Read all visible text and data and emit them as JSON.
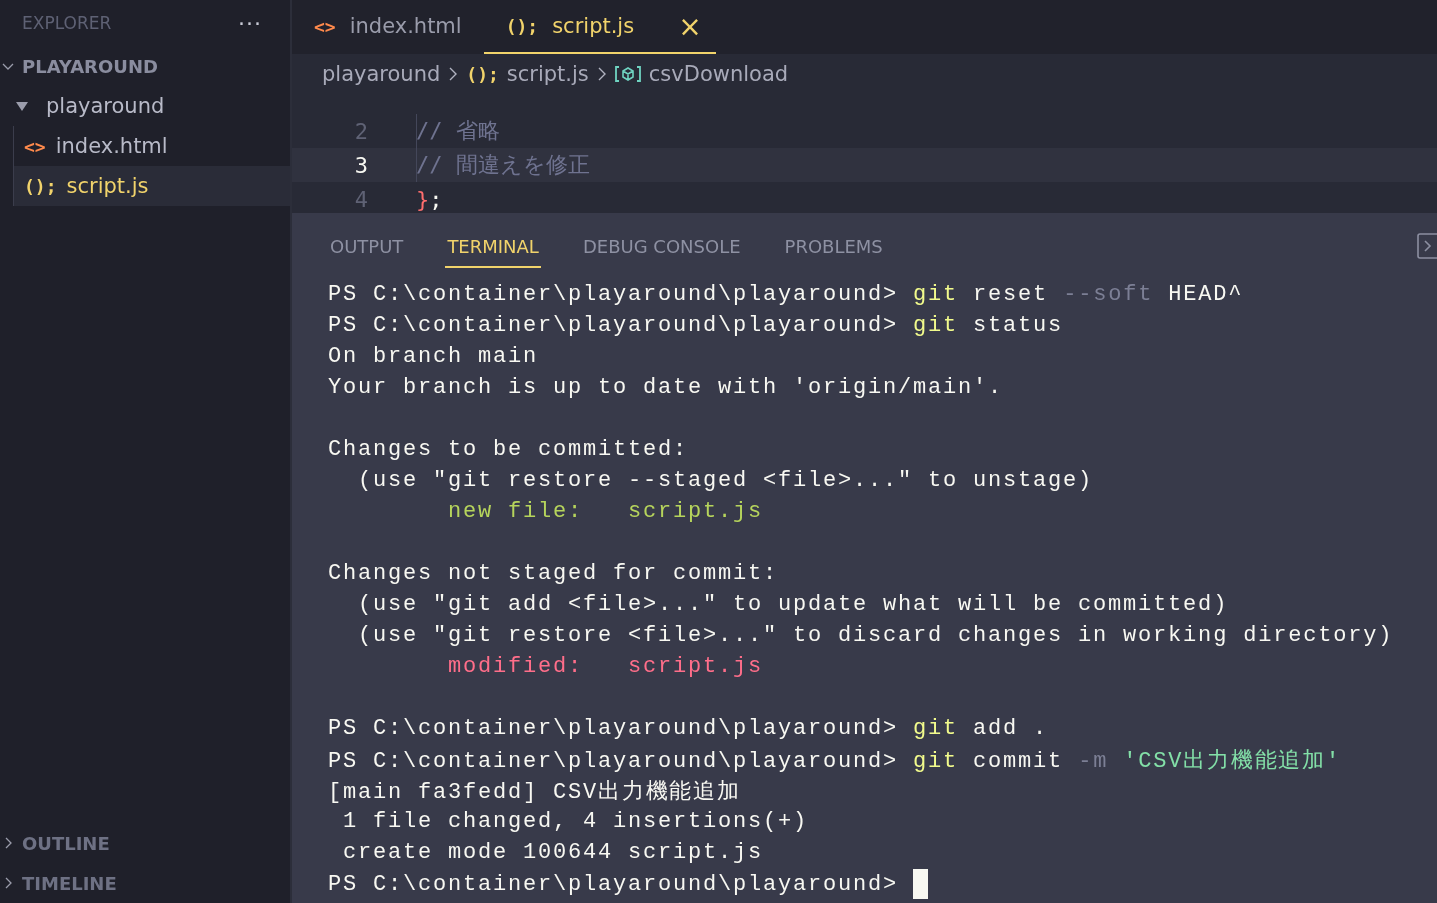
{
  "sidebar": {
    "title": "EXPLORER",
    "more": "···",
    "sections": [
      {
        "label": "PLAYAROUND",
        "expanded": true,
        "tree": [
          {
            "label": "playaround",
            "kind": "folder",
            "expanded": true,
            "selected": false,
            "children": [
              {
                "label": "index.html",
                "kind": "html",
                "icon": "<>",
                "selected": false
              },
              {
                "label": "script.js",
                "kind": "js",
                "icon": "();",
                "selected": true
              }
            ]
          }
        ]
      }
    ],
    "bottom_sections": [
      {
        "label": "OUTLINE",
        "expanded": false
      },
      {
        "label": "TIMELINE",
        "expanded": false
      }
    ]
  },
  "tabs": [
    {
      "label": "index.html",
      "kind": "html",
      "icon": "<>",
      "selected": false
    },
    {
      "label": "script.js",
      "kind": "js",
      "icon": "();",
      "selected": true,
      "close": "×"
    }
  ],
  "breadcrumbs": [
    {
      "label": "playaround",
      "kind": "folder"
    },
    {
      "label": "script.js",
      "kind": "js",
      "icon": "();"
    },
    {
      "label": "csvDownload",
      "kind": "symbol"
    }
  ],
  "code": [
    {
      "number": "2",
      "current": false,
      "tokens": [
        {
          "kind": "comment",
          "text": "// 省略"
        }
      ]
    },
    {
      "number": "3",
      "current": true,
      "tokens": [
        {
          "kind": "comment",
          "text": "// 間違えを修正"
        }
      ]
    },
    {
      "number": "4",
      "current": false,
      "tokens": [
        {
          "kind": "op",
          "text": "}"
        },
        {
          "kind": "plain",
          "text": ";"
        }
      ]
    }
  ],
  "panel_tabs": [
    {
      "label": "OUTPUT",
      "selected": false
    },
    {
      "label": "TERMINAL",
      "selected": true
    },
    {
      "label": "DEBUG CONSOLE",
      "selected": false
    },
    {
      "label": "PROBLEMS",
      "selected": false
    }
  ],
  "terminal": [
    {
      "kind": "text",
      "segments": [
        {
          "kind": "plain",
          "text": "PS C:\\container\\playaround\\playaround> "
        },
        {
          "kind": "cmd",
          "text": "git"
        },
        {
          "kind": "plain",
          "text": " reset "
        },
        {
          "kind": "flag",
          "text": "--soft"
        },
        {
          "kind": "plain",
          "text": " HEAD^"
        }
      ]
    },
    {
      "kind": "text",
      "segments": [
        {
          "kind": "plain",
          "text": "PS C:\\container\\playaround\\playaround> "
        },
        {
          "kind": "cmd",
          "text": "git"
        },
        {
          "kind": "plain",
          "text": " status"
        }
      ]
    },
    {
      "kind": "text",
      "segments": [
        {
          "kind": "plain",
          "text": "On branch main"
        }
      ]
    },
    {
      "kind": "text",
      "segments": [
        {
          "kind": "plain",
          "text": "Your branch is up to date with 'origin/main'."
        }
      ]
    },
    {
      "kind": "blank"
    },
    {
      "kind": "text",
      "segments": [
        {
          "kind": "plain",
          "text": "Changes to be committed:"
        }
      ]
    },
    {
      "kind": "text",
      "segments": [
        {
          "kind": "plain",
          "text": "  (use \"git restore --staged <file>...\" to unstage)"
        }
      ]
    },
    {
      "kind": "text",
      "segments": [
        {
          "kind": "added",
          "text": "        new file:   script.js"
        }
      ]
    },
    {
      "kind": "blank"
    },
    {
      "kind": "text",
      "segments": [
        {
          "kind": "plain",
          "text": "Changes not staged for commit:"
        }
      ]
    },
    {
      "kind": "text",
      "segments": [
        {
          "kind": "plain",
          "text": "  (use \"git add <file>...\" to update what will be committed)"
        }
      ]
    },
    {
      "kind": "text",
      "segments": [
        {
          "kind": "plain",
          "text": "  (use \"git restore <file>...\" to discard changes in working directory)"
        }
      ]
    },
    {
      "kind": "text",
      "segments": [
        {
          "kind": "modified",
          "text": "        modified:   script.js"
        }
      ]
    },
    {
      "kind": "blank"
    },
    {
      "kind": "text",
      "segments": [
        {
          "kind": "plain",
          "text": "PS C:\\container\\playaround\\playaround> "
        },
        {
          "kind": "cmd",
          "text": "git"
        },
        {
          "kind": "plain",
          "text": " add ."
        }
      ]
    },
    {
      "kind": "text",
      "segments": [
        {
          "kind": "plain",
          "text": "PS C:\\container\\playaround\\playaround> "
        },
        {
          "kind": "cmd",
          "text": "git"
        },
        {
          "kind": "plain",
          "text": " commit "
        },
        {
          "kind": "flag",
          "text": "-m"
        },
        {
          "kind": "string",
          "text": " 'CSV出力機能追加'"
        }
      ]
    },
    {
      "kind": "text",
      "segments": [
        {
          "kind": "plain",
          "text": "[main fa3fedd] CSV出力機能追加"
        }
      ]
    },
    {
      "kind": "text",
      "segments": [
        {
          "kind": "plain",
          "text": " 1 file changed, 4 insertions(+)"
        }
      ]
    },
    {
      "kind": "text",
      "segments": [
        {
          "kind": "plain",
          "text": " create mode 100644 script.js"
        }
      ]
    },
    {
      "kind": "text",
      "segments": [
        {
          "kind": "plain",
          "text": "PS C:\\container\\playaround\\playaround> "
        },
        {
          "kind": "cursor"
        }
      ]
    }
  ]
}
